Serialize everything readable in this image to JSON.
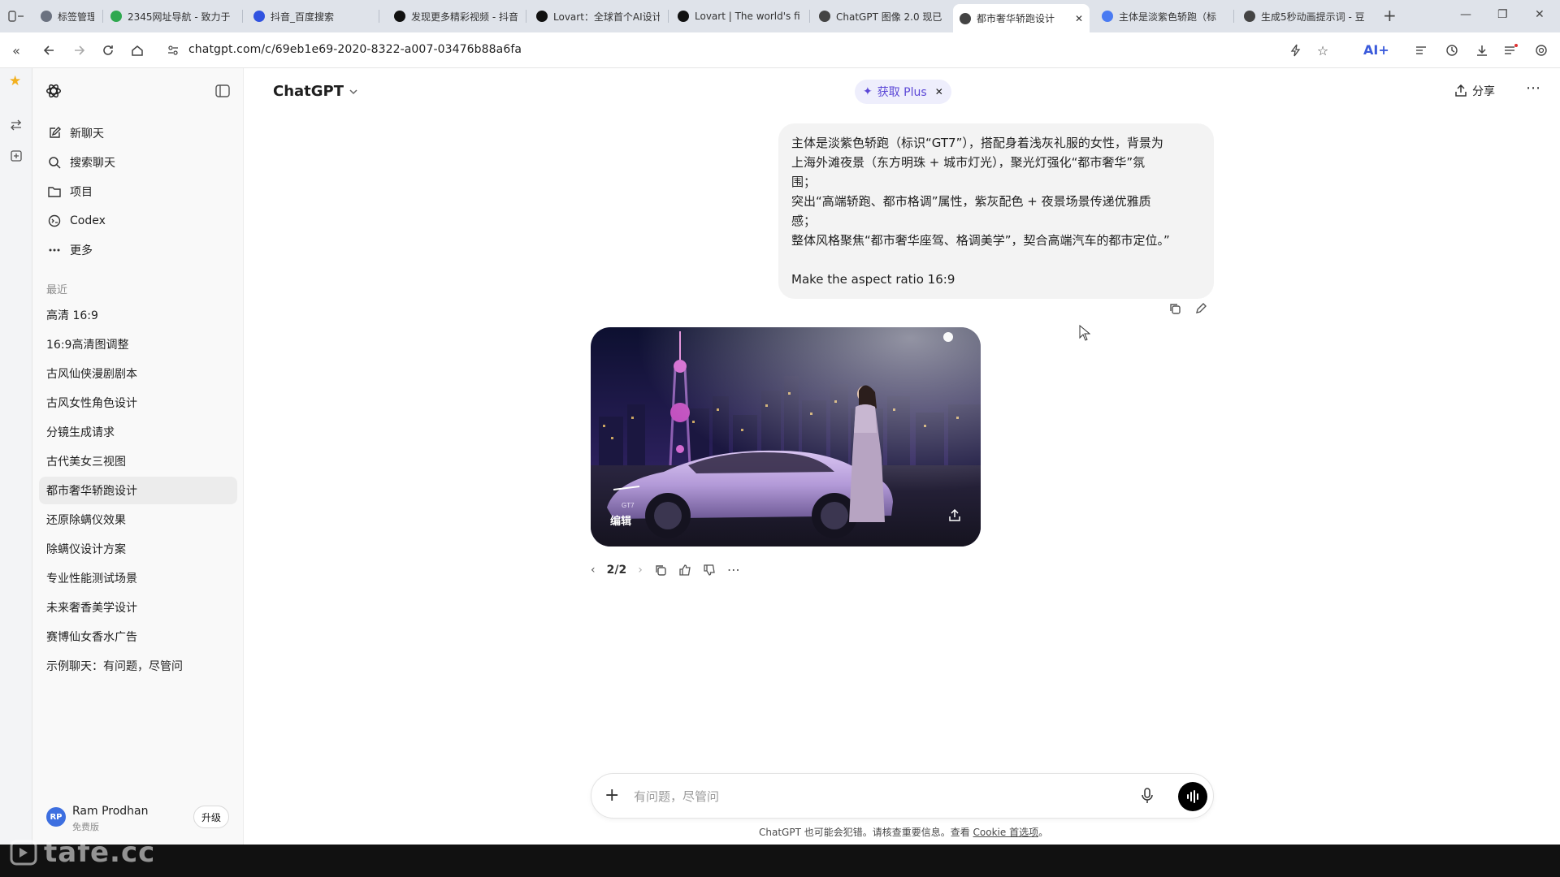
{
  "browser": {
    "tabs": [
      {
        "label": "标签管理",
        "favicon_color": "#6b7280"
      },
      {
        "label": "2345网址导航 - 致力于",
        "favicon_color": "#2fa84f"
      },
      {
        "label": "抖音_百度搜索",
        "favicon_color": "#3153e0"
      },
      {
        "label": "发现更多精彩视频 - 抖音",
        "favicon_color": "#111111"
      },
      {
        "label": "Lovart：全球首个AI设计",
        "favicon_color": "#111111"
      },
      {
        "label": "Lovart | The world's fi",
        "favicon_color": "#111111"
      },
      {
        "label": "ChatGPT 图像 2.0 现已",
        "favicon_color": "#444444"
      },
      {
        "label": "都市奢华轿跑设计",
        "favicon_color": "#444444",
        "active": true
      },
      {
        "label": "主体是淡紫色轿跑（标",
        "favicon_color": "#4a7bf2"
      },
      {
        "label": "生成5秒动画提示词 - 豆",
        "favicon_color": "#444444"
      }
    ],
    "new_tab": "+",
    "url": "chatgpt.com/c/69eb1e69-2020-8322-a007-03476b88a6fa",
    "ai_label": "AI+"
  },
  "sidebar": {
    "nav": [
      {
        "label": "新聊天",
        "icon": "edit-icon"
      },
      {
        "label": "搜索聊天",
        "icon": "search-icon"
      },
      {
        "label": "项目",
        "icon": "folder-icon"
      },
      {
        "label": "Codex",
        "icon": "codex-icon"
      },
      {
        "label": "更多",
        "icon": "more-icon"
      }
    ],
    "recent_label": "最近",
    "recent": [
      "高清 16:9",
      "16:9高清图调整",
      "古风仙侠漫剧剧本",
      "古风女性角色设计",
      "分镜生成请求",
      "古代美女三视图",
      "都市奢华轿跑设计",
      "还原除螨仪效果",
      "除螨仪设计方案",
      "专业性能测试场景",
      "未来奢香美学设计",
      "赛博仙女香水广告",
      "示例聊天：有问题，尽管问"
    ],
    "selected_index": 6,
    "user": {
      "initials": "RP",
      "name": "Ram Prodhan",
      "plan": "免费版",
      "upgrade": "升级"
    }
  },
  "header": {
    "model": "ChatGPT",
    "plus_label": "获取 Plus",
    "share_label": "分享"
  },
  "conversation": {
    "user_message_lines": [
      "主体是淡紫色轿跑（标识“GT7”），搭配身着浅灰礼服的女性，背景为",
      "上海外滩夜景（东方明珠 + 城市灯光），聚光灯强化“都市奢华”氛",
      "围；",
      "突出“高端轿跑、都市格调”属性，紫灰配色 + 夜景场景传递优雅质",
      "感；",
      "整体风格聚焦“都市奢华座驾、格调美学”，契合高端汽车的都市定位。”",
      "",
      "Make the aspect ratio 16:9"
    ],
    "image": {
      "edit_label": "编辑",
      "car_badge": "GT7"
    },
    "pager": "2/2"
  },
  "composer": {
    "placeholder": "有问题，尽管问",
    "disclaimer_text": "ChatGPT 也可能会犯错。请核查重要信息。查看 ",
    "disclaimer_link": "Cookie 首选项",
    "disclaimer_end": "。"
  },
  "watermark": "tafe.cc",
  "colors": {
    "accent": "#5b47d6",
    "selected_bg": "#ececec",
    "car": "#b39ad8"
  }
}
